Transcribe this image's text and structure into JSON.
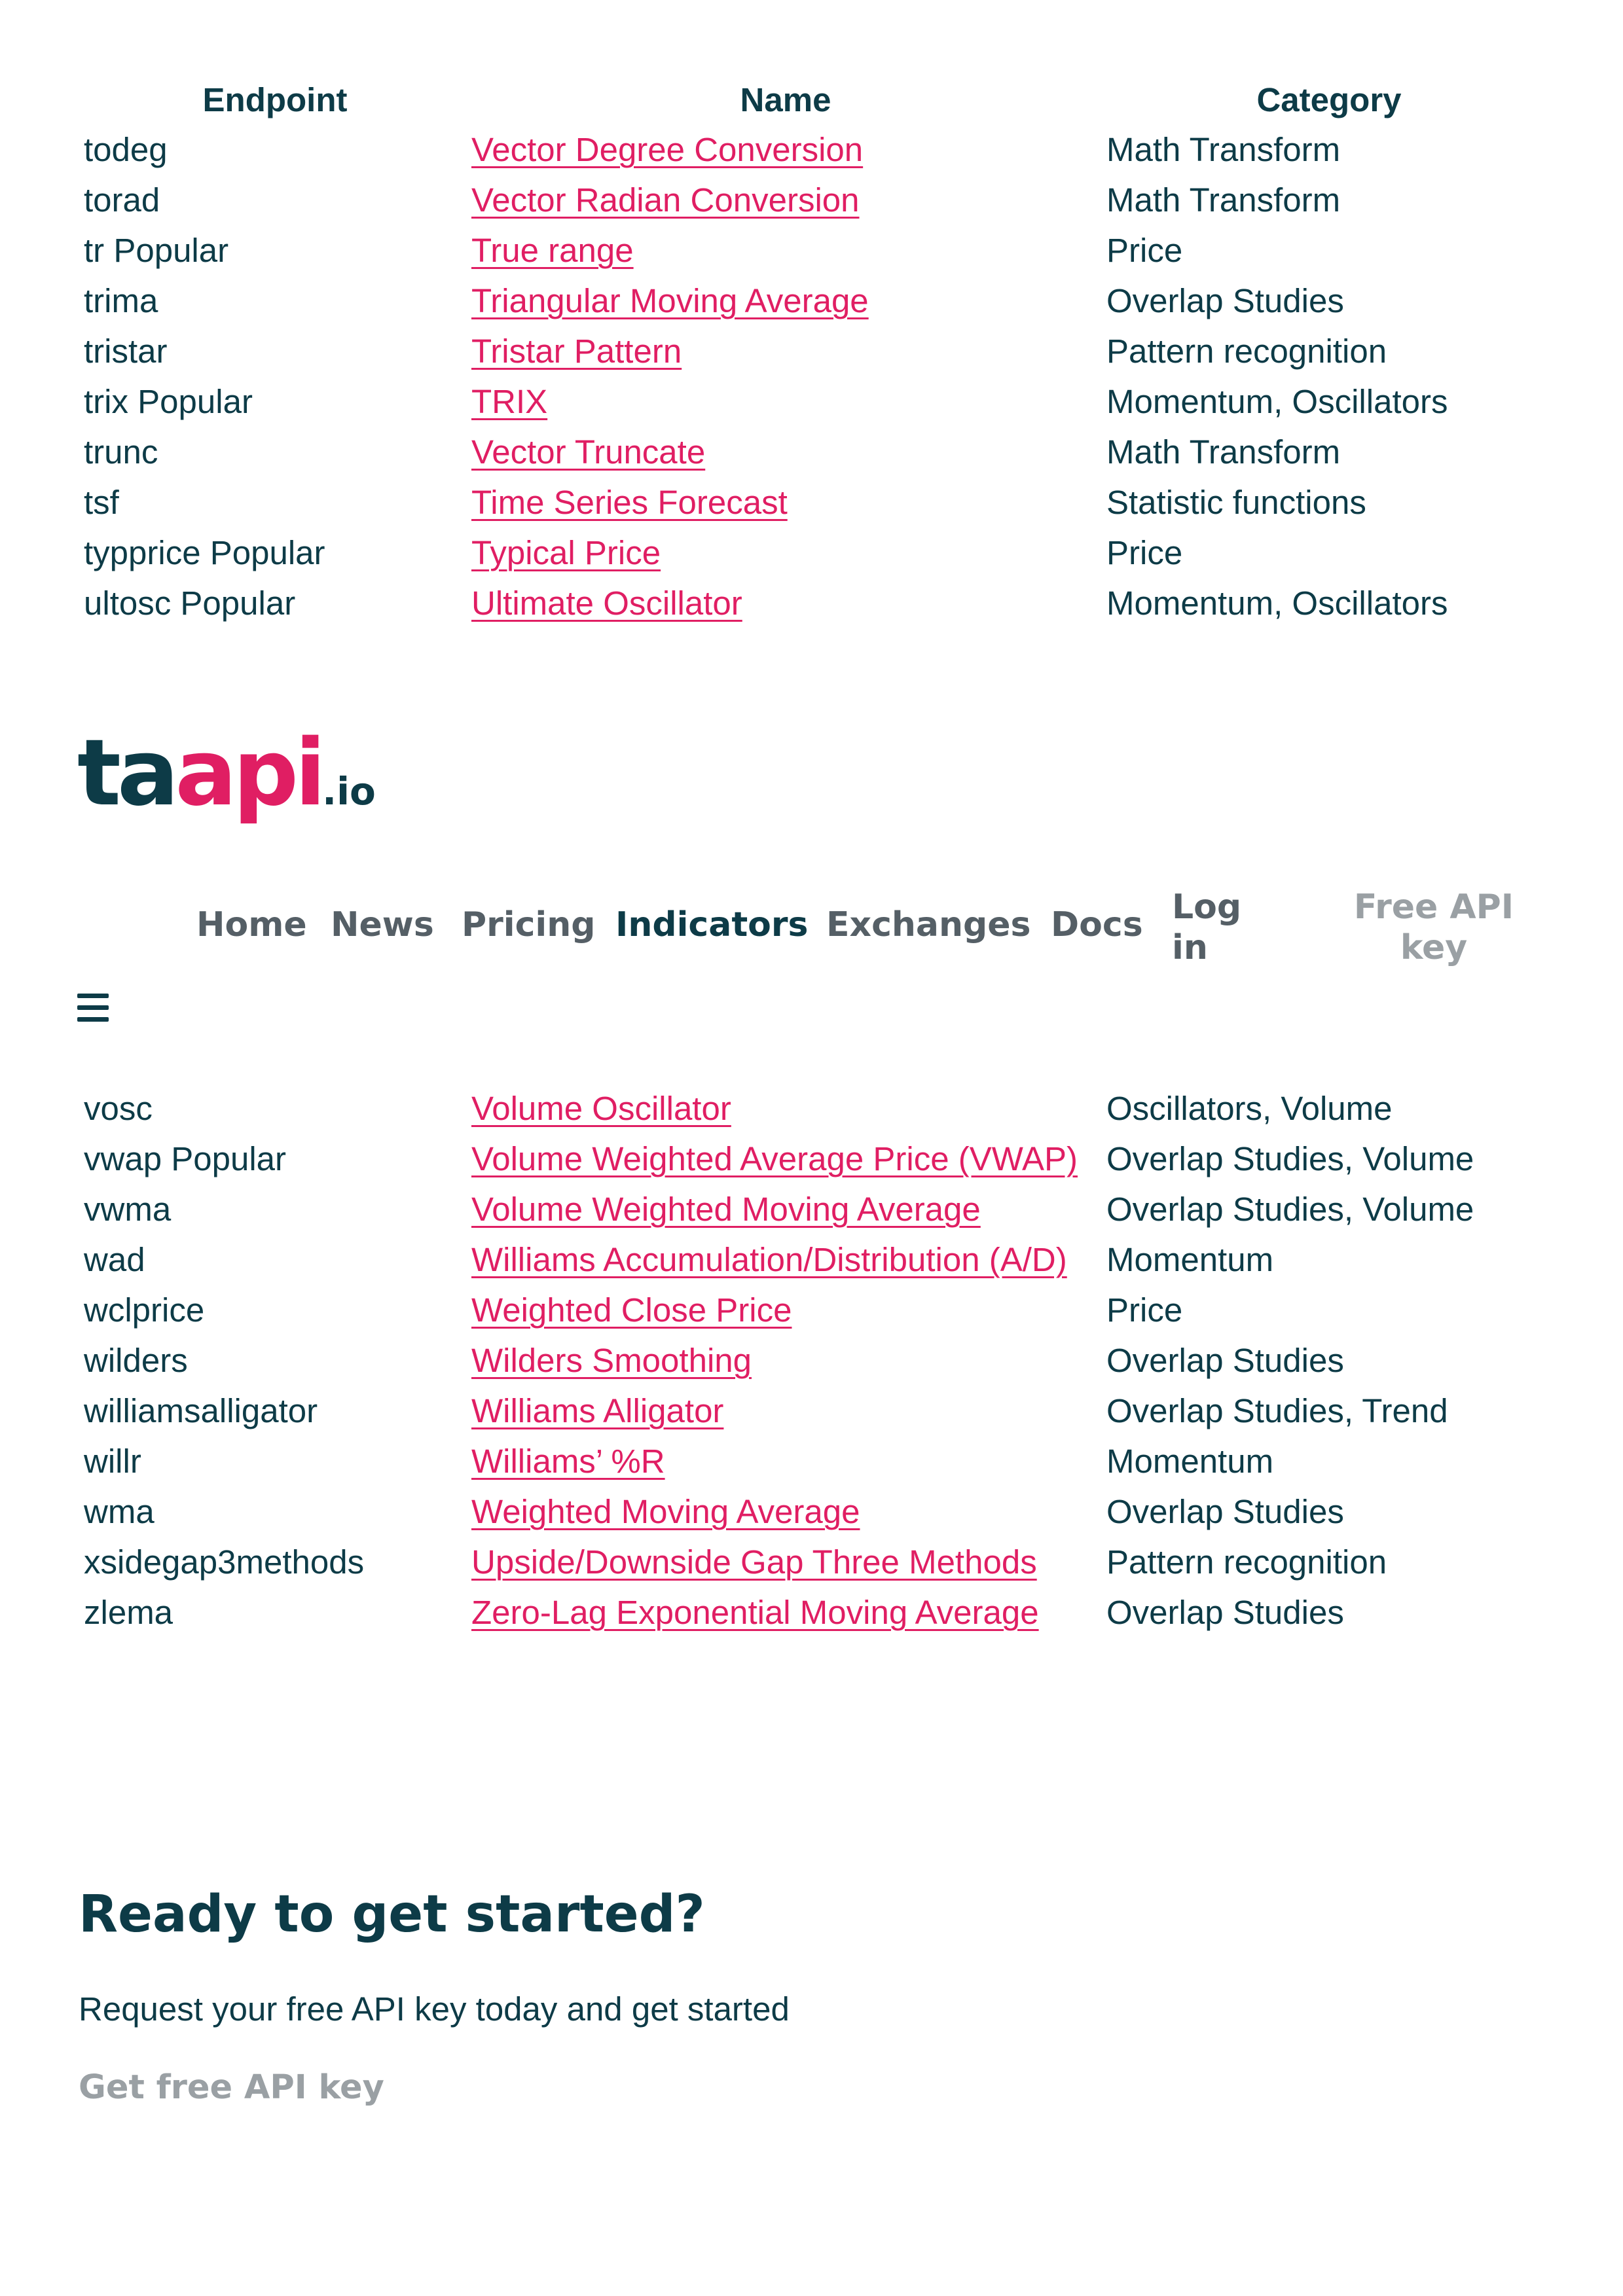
{
  "table_top": {
    "headers": {
      "endpoint": "Endpoint",
      "name": "Name",
      "category": "Category"
    },
    "rows": [
      {
        "endpoint": "todeg",
        "name": "Vector Degree Conversion",
        "category": "Math Transform"
      },
      {
        "endpoint": "torad",
        "name": "Vector Radian Conversion",
        "category": "Math Transform"
      },
      {
        "endpoint": "tr Popular",
        "name": "True range",
        "category": "Price"
      },
      {
        "endpoint": "trima",
        "name": "Triangular Moving Average",
        "category": "Overlap Studies"
      },
      {
        "endpoint": "tristar",
        "name": "Tristar Pattern",
        "category": "Pattern recognition"
      },
      {
        "endpoint": "trix Popular",
        "name": "TRIX",
        "category": "Momentum, Oscillators"
      },
      {
        "endpoint": "trunc",
        "name": "Vector Truncate",
        "category": "Math Transform"
      },
      {
        "endpoint": "tsf",
        "name": "Time Series Forecast",
        "category": "Statistic functions"
      },
      {
        "endpoint": "typprice Popular",
        "name": "Typical Price",
        "category": "Price"
      },
      {
        "endpoint": "ultosc Popular",
        "name": "Ultimate Oscillator",
        "category": "Momentum, Oscillators"
      }
    ]
  },
  "logo": {
    "part1": "ta",
    "part2": "api",
    "part3": ".io"
  },
  "nav": {
    "home": "Home",
    "news": "News",
    "pricing": "Pricing",
    "indicators": "Indicators",
    "exchanges": "Exchanges",
    "docs": "Docs",
    "login_line1": "Log",
    "login_line2": "in",
    "free_key_line1": "Free API",
    "free_key_line2": "key",
    "menu_icon": "hamburger-menu-icon"
  },
  "table_bottom": {
    "rows": [
      {
        "endpoint": "vosc",
        "name": "Volume Oscillator",
        "category": "Oscillators, Volume"
      },
      {
        "endpoint": "vwap Popular",
        "name": "Volume Weighted Average Price (VWAP)",
        "category": "Overlap Studies, Volume"
      },
      {
        "endpoint": "vwma",
        "name": "Volume Weighted Moving Average",
        "category": "Overlap Studies, Volume"
      },
      {
        "endpoint": "wad",
        "name": "Williams Accumulation/Distribution (A/D)",
        "category": "Momentum"
      },
      {
        "endpoint": "wclprice",
        "name": "Weighted Close Price",
        "category": "Price"
      },
      {
        "endpoint": "wilders",
        "name": "Wilders Smoothing",
        "category": "Overlap Studies"
      },
      {
        "endpoint": "williamsalligator",
        "name": "Williams Alligator",
        "category": "Overlap Studies, Trend"
      },
      {
        "endpoint": "willr",
        "name": "Williams’ %R",
        "category": "Momentum"
      },
      {
        "endpoint": "wma",
        "name": "Weighted Moving Average",
        "category": "Overlap Studies"
      },
      {
        "endpoint": "xsidegap3methods",
        "name": "Upside/Downside Gap Three Methods",
        "category": "Pattern recognition"
      },
      {
        "endpoint": "zlema",
        "name": "Zero-Lag Exponential Moving Average",
        "category": "Overlap Studies"
      }
    ]
  },
  "cta": {
    "title": "Ready to get started?",
    "text": "Request your free API key today and get started",
    "link": "Get free API key"
  },
  "colors": {
    "brand_dark": "#0d3b47",
    "brand_pink": "#e01e63",
    "muted": "#9aa0a4"
  }
}
